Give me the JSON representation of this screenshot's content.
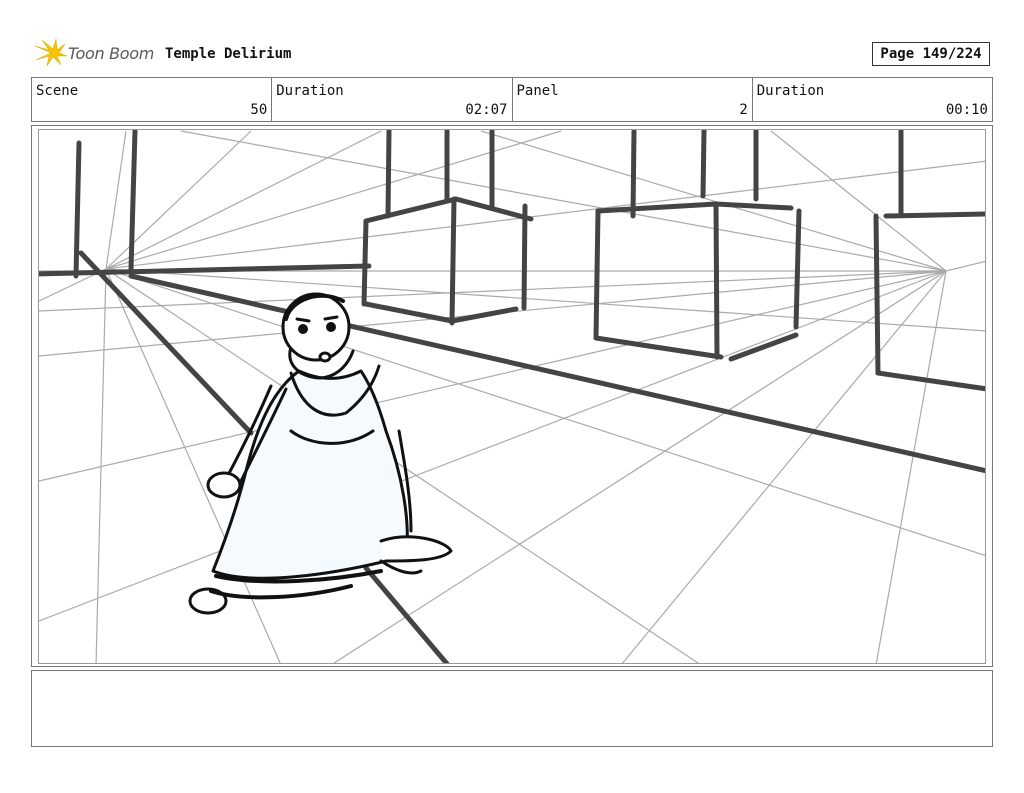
{
  "header": {
    "brand": "Toon Boom",
    "project_title": "Temple Delirium",
    "page_label": "Page 149/224"
  },
  "info": {
    "scene_label": "Scene",
    "scene_value": "50",
    "scene_duration_label": "Duration",
    "scene_duration_value": "02:07",
    "panel_label": "Panel",
    "panel_value": "2",
    "panel_duration_label": "Duration",
    "panel_duration_value": "00:10"
  },
  "notes": {
    "text": ""
  }
}
